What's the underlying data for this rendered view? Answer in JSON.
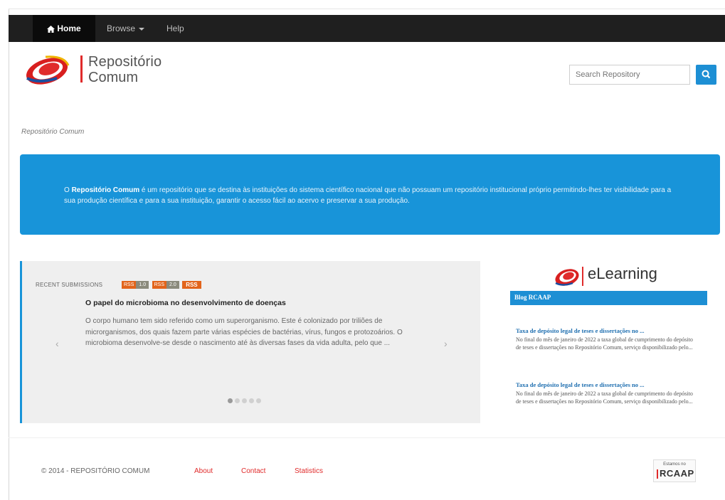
{
  "nav": {
    "home_label": "Home",
    "browse_label": "Browse",
    "help_label": "Help"
  },
  "header": {
    "logo_line1": "Repositório",
    "logo_line2": "Comum",
    "search_placeholder": "Search Repository"
  },
  "breadcrumb": "Repositório Comum",
  "banner": {
    "prefix": "O ",
    "brand": "Repositório Comum",
    "text": " é um repositório que se destina às instituições do sistema científico nacional que não possuam um repositório institucional próprio permitindo-lhes ter visibilidade para a sua produção científica e para a sua instituição, garantir o acesso fácil ao acervo e preservar a sua produção."
  },
  "recent": {
    "heading": "RECENT SUBMISSIONS",
    "feeds": [
      {
        "left": "RSS",
        "right": "1.0"
      },
      {
        "left": "RSS",
        "right": "2.0"
      }
    ],
    "rss_label": "RSS",
    "title": "O papel do microbioma no desenvolvimento de doenças",
    "body": "O corpo humano tem sido referido como um superorganismo. Este é colonizado por triliões de microrganismos, dos quais fazem parte várias espécies de bactérias, vírus, fungos e protozoários. O microbioma desenvolve-se desde o nascimento até às diversas fases da vida adulta, pelo que ...",
    "prev_label": "‹",
    "next_label": "›",
    "dots": 5,
    "active_dot": 0
  },
  "sidebar": {
    "elearning_label": "eLearning",
    "blog_label": "Blog RCAAP",
    "posts": [
      {
        "title": "Taxa de depósito legal de teses e dissertações no ...",
        "body": "No final do mês de janeiro de 2022 a taxa global de cumprimento do depósito de teses e dissertações no Repositório Comum, serviço disponibilizado pelo..."
      },
      {
        "title": "Taxa de depósito legal de teses e dissertações no ...",
        "body": "No final do mês de janeiro de 2022 a taxa global de cumprimento do depósito de teses e dissertações no Repositório Comum, serviço disponibilizado pelo..."
      }
    ]
  },
  "footer": {
    "copyright": "© 2014 - REPOSITÓRIO COMUM",
    "about": "About",
    "contact": "Contact",
    "statistics": "Statistics",
    "badge_small": "Estamos no",
    "badge_big": "RCAAP"
  },
  "colors": {
    "accent_blue": "#1894d9",
    "brand_red": "#e02b2b",
    "navbar": "#1f1f1f"
  }
}
